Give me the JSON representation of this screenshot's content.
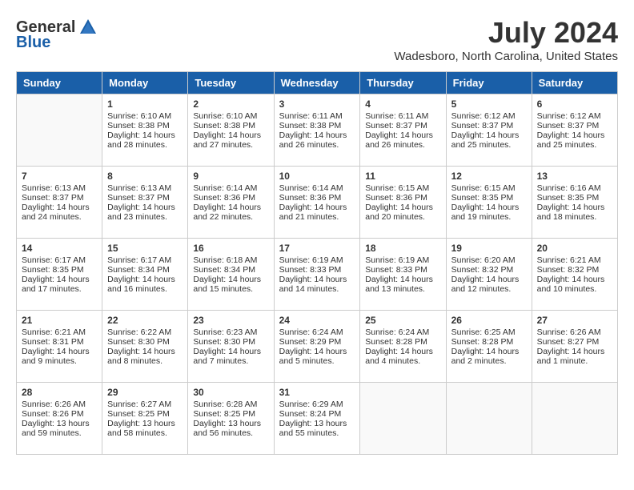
{
  "header": {
    "logo_general": "General",
    "logo_blue": "Blue",
    "month": "July 2024",
    "location": "Wadesboro, North Carolina, United States"
  },
  "days_of_week": [
    "Sunday",
    "Monday",
    "Tuesday",
    "Wednesday",
    "Thursday",
    "Friday",
    "Saturday"
  ],
  "weeks": [
    [
      {
        "day": "",
        "info": ""
      },
      {
        "day": "1",
        "info": "Sunrise: 6:10 AM\nSunset: 8:38 PM\nDaylight: 14 hours\nand 28 minutes."
      },
      {
        "day": "2",
        "info": "Sunrise: 6:10 AM\nSunset: 8:38 PM\nDaylight: 14 hours\nand 27 minutes."
      },
      {
        "day": "3",
        "info": "Sunrise: 6:11 AM\nSunset: 8:38 PM\nDaylight: 14 hours\nand 26 minutes."
      },
      {
        "day": "4",
        "info": "Sunrise: 6:11 AM\nSunset: 8:37 PM\nDaylight: 14 hours\nand 26 minutes."
      },
      {
        "day": "5",
        "info": "Sunrise: 6:12 AM\nSunset: 8:37 PM\nDaylight: 14 hours\nand 25 minutes."
      },
      {
        "day": "6",
        "info": "Sunrise: 6:12 AM\nSunset: 8:37 PM\nDaylight: 14 hours\nand 25 minutes."
      }
    ],
    [
      {
        "day": "7",
        "info": "Sunrise: 6:13 AM\nSunset: 8:37 PM\nDaylight: 14 hours\nand 24 minutes."
      },
      {
        "day": "8",
        "info": "Sunrise: 6:13 AM\nSunset: 8:37 PM\nDaylight: 14 hours\nand 23 minutes."
      },
      {
        "day": "9",
        "info": "Sunrise: 6:14 AM\nSunset: 8:36 PM\nDaylight: 14 hours\nand 22 minutes."
      },
      {
        "day": "10",
        "info": "Sunrise: 6:14 AM\nSunset: 8:36 PM\nDaylight: 14 hours\nand 21 minutes."
      },
      {
        "day": "11",
        "info": "Sunrise: 6:15 AM\nSunset: 8:36 PM\nDaylight: 14 hours\nand 20 minutes."
      },
      {
        "day": "12",
        "info": "Sunrise: 6:15 AM\nSunset: 8:35 PM\nDaylight: 14 hours\nand 19 minutes."
      },
      {
        "day": "13",
        "info": "Sunrise: 6:16 AM\nSunset: 8:35 PM\nDaylight: 14 hours\nand 18 minutes."
      }
    ],
    [
      {
        "day": "14",
        "info": "Sunrise: 6:17 AM\nSunset: 8:35 PM\nDaylight: 14 hours\nand 17 minutes."
      },
      {
        "day": "15",
        "info": "Sunrise: 6:17 AM\nSunset: 8:34 PM\nDaylight: 14 hours\nand 16 minutes."
      },
      {
        "day": "16",
        "info": "Sunrise: 6:18 AM\nSunset: 8:34 PM\nDaylight: 14 hours\nand 15 minutes."
      },
      {
        "day": "17",
        "info": "Sunrise: 6:19 AM\nSunset: 8:33 PM\nDaylight: 14 hours\nand 14 minutes."
      },
      {
        "day": "18",
        "info": "Sunrise: 6:19 AM\nSunset: 8:33 PM\nDaylight: 14 hours\nand 13 minutes."
      },
      {
        "day": "19",
        "info": "Sunrise: 6:20 AM\nSunset: 8:32 PM\nDaylight: 14 hours\nand 12 minutes."
      },
      {
        "day": "20",
        "info": "Sunrise: 6:21 AM\nSunset: 8:32 PM\nDaylight: 14 hours\nand 10 minutes."
      }
    ],
    [
      {
        "day": "21",
        "info": "Sunrise: 6:21 AM\nSunset: 8:31 PM\nDaylight: 14 hours\nand 9 minutes."
      },
      {
        "day": "22",
        "info": "Sunrise: 6:22 AM\nSunset: 8:30 PM\nDaylight: 14 hours\nand 8 minutes."
      },
      {
        "day": "23",
        "info": "Sunrise: 6:23 AM\nSunset: 8:30 PM\nDaylight: 14 hours\nand 7 minutes."
      },
      {
        "day": "24",
        "info": "Sunrise: 6:24 AM\nSunset: 8:29 PM\nDaylight: 14 hours\nand 5 minutes."
      },
      {
        "day": "25",
        "info": "Sunrise: 6:24 AM\nSunset: 8:28 PM\nDaylight: 14 hours\nand 4 minutes."
      },
      {
        "day": "26",
        "info": "Sunrise: 6:25 AM\nSunset: 8:28 PM\nDaylight: 14 hours\nand 2 minutes."
      },
      {
        "day": "27",
        "info": "Sunrise: 6:26 AM\nSunset: 8:27 PM\nDaylight: 14 hours\nand 1 minute."
      }
    ],
    [
      {
        "day": "28",
        "info": "Sunrise: 6:26 AM\nSunset: 8:26 PM\nDaylight: 13 hours\nand 59 minutes."
      },
      {
        "day": "29",
        "info": "Sunrise: 6:27 AM\nSunset: 8:25 PM\nDaylight: 13 hours\nand 58 minutes."
      },
      {
        "day": "30",
        "info": "Sunrise: 6:28 AM\nSunset: 8:25 PM\nDaylight: 13 hours\nand 56 minutes."
      },
      {
        "day": "31",
        "info": "Sunrise: 6:29 AM\nSunset: 8:24 PM\nDaylight: 13 hours\nand 55 minutes."
      },
      {
        "day": "",
        "info": ""
      },
      {
        "day": "",
        "info": ""
      },
      {
        "day": "",
        "info": ""
      }
    ]
  ]
}
